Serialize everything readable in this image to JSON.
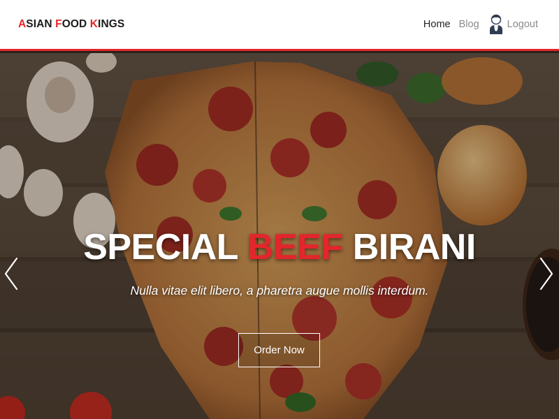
{
  "brand": {
    "parts": [
      {
        "text": "A",
        "accent": true
      },
      {
        "text": "SIAN ",
        "accent": false
      },
      {
        "text": "F",
        "accent": true
      },
      {
        "text": "OOD ",
        "accent": false
      },
      {
        "text": "K",
        "accent": true
      },
      {
        "text": "INGS",
        "accent": false
      }
    ]
  },
  "nav": {
    "home": "Home",
    "blog": "Blog",
    "logout": "Logout",
    "user_icon": "user-avatar-icon"
  },
  "hero": {
    "headline_pre": "SPECIAL ",
    "headline_accent": "BEEF",
    "headline_post": " BIRANI",
    "subline": "Nulla vitae elit libero, a pharetra augue mollis interdum.",
    "button": "Order Now",
    "prev_icon": "chevron-left-icon",
    "next_icon": "chevron-right-icon"
  },
  "colors": {
    "accent": "#e3262c",
    "nav_background": "#ffffff",
    "text_dark": "#222222",
    "text_muted": "#8a8a8a"
  }
}
